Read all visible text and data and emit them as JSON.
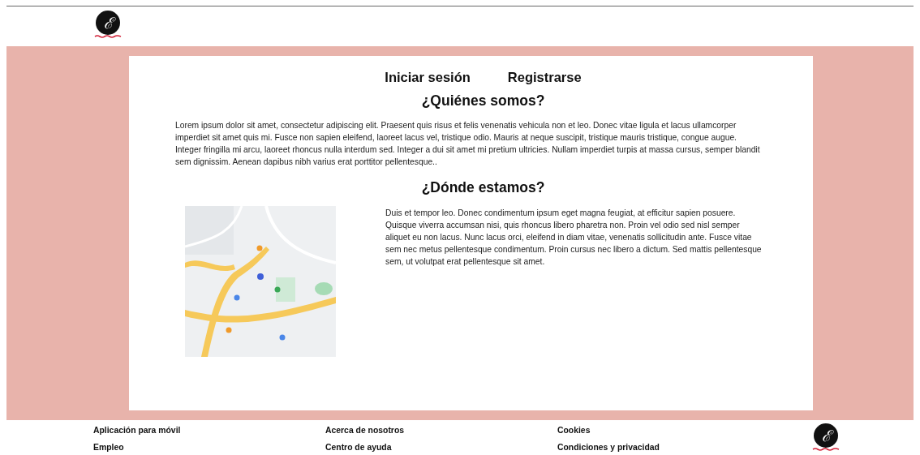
{
  "header": {
    "logo": {
      "mark": "ℰ"
    }
  },
  "nav": [
    {
      "label": "Iniciar sesión"
    },
    {
      "label": "Registrarse"
    }
  ],
  "about": {
    "title": "¿Quiénes somos?",
    "text": "Lorem ipsum dolor sit amet, consectetur adipiscing elit. Praesent quis risus et felis venenatis vehicula non et leo. Donec vitae ligula et lacus ullamcorper imperdiet sit amet quis mi. Fusce non sapien eleifend, laoreet lacus vel, tristique odio. Mauris at neque suscipit, tristique mauris tristique, congue augue. Integer fringilla mi arcu, laoreet rhoncus nulla interdum sed. Integer a dui sit amet mi pretium ultricies. Nullam imperdiet turpis at massa cursus, semper blandit sem dignissim. Aenean dapibus nibh varius erat porttitor pellentesque.."
  },
  "location": {
    "title": "¿Dónde estamos?",
    "text": "Duis et tempor leo. Donec condimentum ipsum eget magna feugiat, at efficitur sapien posuere. Quisque viverra accumsan nisi, quis rhoncus libero pharetra non. Proin vel odio sed nisl semper aliquet eu non lacus. Nunc lacus orci, eleifend in diam vitae, venenatis sollicitudin ante. Fusce vitae sem nec metus pellentesque condimentum. Proin cursus nec libero a dictum. Sed mattis pellentesque sem, ut volutpat erat pellentesque sit amet."
  },
  "footer": {
    "columns": [
      {
        "links": [
          "Aplicación para móvil",
          "Empleo"
        ]
      },
      {
        "links": [
          "Acerca de nosotros",
          "Centro de ayuda"
        ]
      },
      {
        "links": [
          "Cookies",
          "Condiciones y privacidad"
        ]
      }
    ],
    "logo": {
      "mark": "ℰ"
    }
  }
}
